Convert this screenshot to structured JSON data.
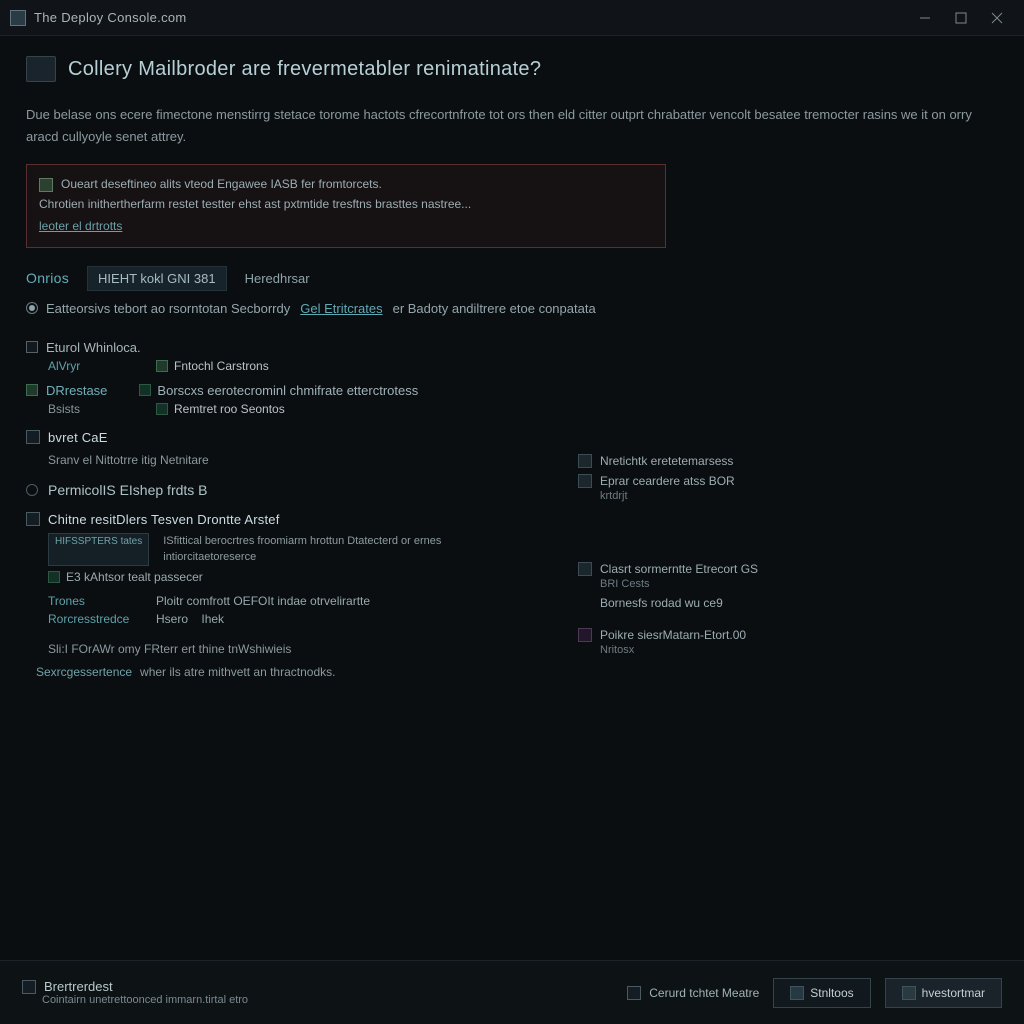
{
  "window": {
    "title": "The Deploy Console.com"
  },
  "page": {
    "heading": "Collery Mailbroder are frevermetabler renimatinate?",
    "intro": "Due belase ons ecere fimectone menstirrg stetace torome hactots cfrecortnfrote tot ors then eld citter outprt chrabatter vencolt besatee tremocter rasins we it on orry aracd cullyoyle senet attrey."
  },
  "notice": {
    "line1": "Oueart deseftineo alits vteod Engawee IASB fer fromtorcets.",
    "line2": "Chrotien inithertherfarm restet testter ehst ast pxtmtide tresftns brasttes nastree...",
    "link": "leoter el drtrotts"
  },
  "section": {
    "tab": "Onrios",
    "panel": "HIEHT kokl GNI 381",
    "panel_tail": "Heredhrsar",
    "radio_text_a": "Eatteorsivs tebort ao rsorntotan Secborrdy",
    "radio_link": "Gel Etritcrates",
    "radio_text_b": "er Badoty andiltrere etoe conpatata"
  },
  "leftOpts": {
    "row1_title": "Eturol Whinloca.",
    "row1_sub": "AlVryr",
    "row1_val": "Fntochl Carstrons",
    "row2_icon_title": "DRrestase",
    "row2_val": "Borscxs eerotecrominl chmifrate etterctrotess",
    "row3_key": "Bsists",
    "row3_val": "Remtret roo Seontos"
  },
  "leftBlock2": {
    "title": "bvret CaE",
    "sub": "Sranv el Nittotrre itig Netnitare"
  },
  "midHeader": {
    "title": "PermicolIS EIshep frdts B"
  },
  "configBlock": {
    "title": "Chitne resitDlers Tesven Drontte Arstef",
    "boxkey": "HIFSSPTERS tates",
    "desc": "ISfittical berocrtres froomiarm hrottun Dtatecterd or ernes intiorcitaetoreserce",
    "row2_val": "E3 kAhtsor tealt passecer",
    "pair1_k": "Trones",
    "pair1_v": "Ploitr comfrott OEFOIt indae otrvelirartte",
    "pair2_k": "Rorcresstredce",
    "pair2_v1": "Hsero",
    "pair2_v2": "Ihek",
    "tail": "Sli:I FOrAWr omy FRterr ert thine tnWshiwieis",
    "bottom_k": "Sexrcgessertence",
    "bottom_v": "wher ils atre mithvett an thractnodks."
  },
  "rightCol": {
    "r1_title": "Nretichtk eretetemarsess",
    "r2_title": "Eprar ceardere atss BOR",
    "r2_sub": "krtdrjt",
    "r3_title": "Clasrt sormerntte Etrecort GS",
    "r3_sub": "BRI Cests",
    "r4_title": "Bornesfs rodad wu ce9",
    "r5_title": "Poikre siesrMatarn-Etort.00",
    "r5_sub": "Nritosx"
  },
  "footer": {
    "left_title": "Brertrerdest",
    "left_sub": "Cointairn unetrettoonced immarn.tirtal etro",
    "mid": "Cerurd tchtet Meatre",
    "btn1": "Stnltoos",
    "btn2": "hvestortmar"
  }
}
